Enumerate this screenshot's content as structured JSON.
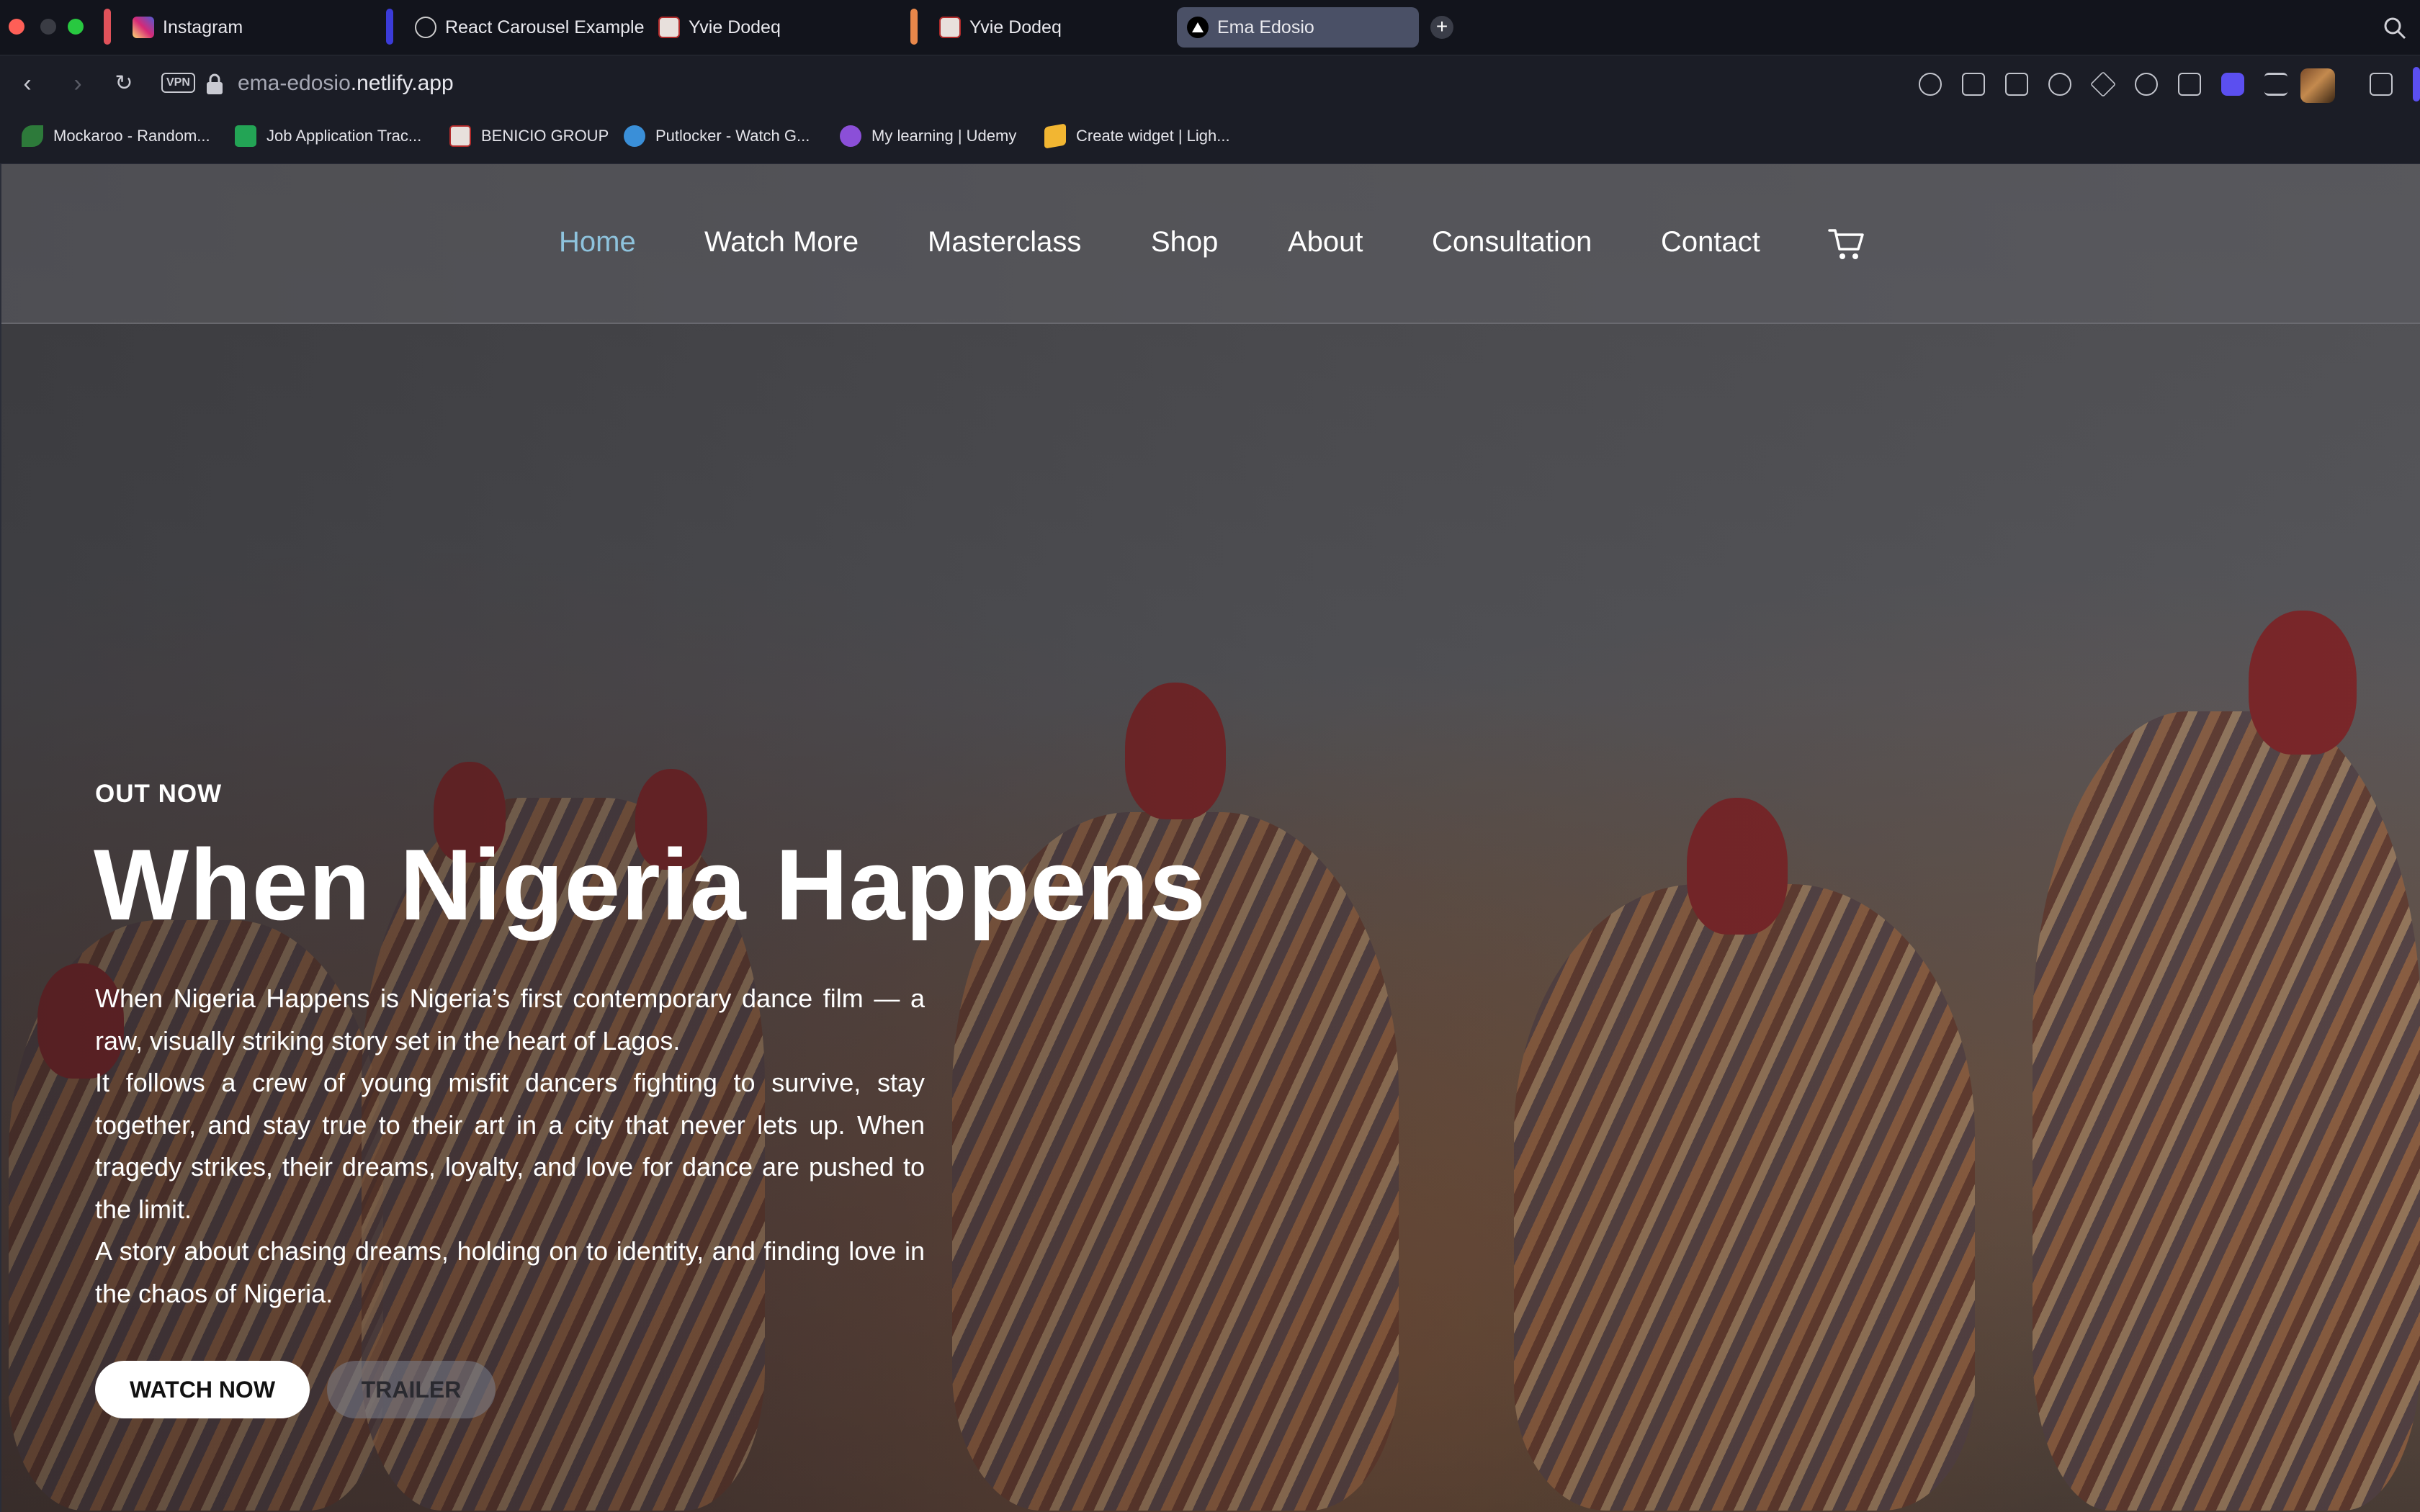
{
  "browser": {
    "tabs": [
      {
        "label": "Instagram"
      },
      {
        "label": "React Carousel Example"
      },
      {
        "label": "Yvie Dodeq"
      },
      {
        "label": "Yvie Dodeq"
      },
      {
        "label": "Ema Edosio"
      }
    ],
    "new_tab": "+",
    "url_host": "ema-edosio",
    "url_domain": ".netlify.app",
    "vpn_label": "VPN",
    "bookmarks": [
      {
        "label": "Mockaroo - Random..."
      },
      {
        "label": "Job Application Trac..."
      },
      {
        "label": "BENICIO GROUP"
      },
      {
        "label": "Putlocker - Watch G..."
      },
      {
        "label": "My learning | Udemy"
      },
      {
        "label": "Create widget | Ligh..."
      }
    ],
    "colors": {
      "accent": "#5b4ff0",
      "active_nav": "#8ec3dd"
    }
  },
  "site": {
    "nav": [
      {
        "label": "Home",
        "active": true
      },
      {
        "label": "Watch More"
      },
      {
        "label": "Masterclass"
      },
      {
        "label": "Shop"
      },
      {
        "label": "About"
      },
      {
        "label": "Consultation"
      },
      {
        "label": "Contact"
      }
    ],
    "cart_icon": "cart-icon",
    "hero": {
      "eyebrow": "OUT NOW",
      "title": "When Nigeria Happens",
      "paragraphs": [
        "When Nigeria Happens is Nigeria’s first contemporary dance film — a raw, visually striking story set in the heart of Lagos.",
        "It follows a crew of young misfit dancers fighting to survive, stay together, and stay true to their art in a city that never lets up. When tragedy strikes, their dreams, loyalty, and love for dance are pushed to the limit.",
        "A story about chasing dreams, holding on to identity, and finding love in the chaos of Nigeria."
      ],
      "primary_button": "WATCH NOW",
      "secondary_button": "TRAILER"
    }
  }
}
